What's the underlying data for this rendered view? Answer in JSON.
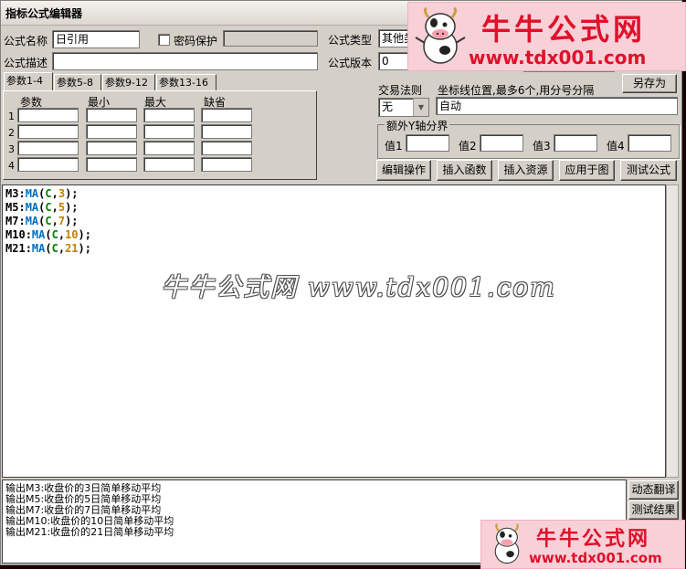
{
  "window": {
    "title": "指标公式编辑器"
  },
  "form": {
    "name_label": "公式名称",
    "name_value": "日引用",
    "password_label": "密码保护",
    "desc_label": "公式描述",
    "desc_value": "",
    "type_label": "公式类型",
    "type_value": "其他类",
    "version_label": "公式版本",
    "version_value": "0"
  },
  "tabs": [
    "参数1-4",
    "参数5-8",
    "参数9-12",
    "参数13-16"
  ],
  "params": {
    "headers": [
      "参数",
      "最小",
      "最大",
      "缺省"
    ],
    "rows": [
      "1",
      "2",
      "3",
      "4"
    ]
  },
  "trade": {
    "rule_label": "交易法则",
    "rule_value": "无",
    "axis_label": "坐标线位置,最多6个,用分号分隔",
    "axis_value": "自动"
  },
  "buttons": {
    "save_as": "另存为",
    "edit_ops": "编辑操作",
    "insert_func": "插入函数",
    "insert_res": "插入资源",
    "apply_chart": "应用于图",
    "test_formula": "测试公式",
    "dyn_translate": "动态翻译",
    "test_result": "测试结果"
  },
  "yaxis": {
    "group_label": "额外Y轴分界",
    "v1": "值1",
    "v2": "值2",
    "v3": "值3",
    "v4": "值4"
  },
  "code": [
    {
      "name": "M3",
      "func": "MA",
      "arg": "C",
      "n": "3"
    },
    {
      "name": "M5",
      "func": "MA",
      "arg": "C",
      "n": "5"
    },
    {
      "name": "M7",
      "func": "MA",
      "arg": "C",
      "n": "7"
    },
    {
      "name": "M10",
      "func": "MA",
      "arg": "C",
      "n": "10"
    },
    {
      "name": "M21",
      "func": "MA",
      "arg": "C",
      "n": "21"
    }
  ],
  "output_lines": [
    "输出M3:收盘价的3日简单移动平均",
    "输出M5:收盘价的5日简单移动平均",
    "输出M7:收盘价的7日简单移动平均",
    "输出M10:收盘价的10日简单移动平均",
    "输出M21:收盘价的21日简单移动平均"
  ],
  "watermark": "牛牛公式网 www.tdx001.com",
  "logo": {
    "cn": "牛牛公式网",
    "url": "www.tdx001.com"
  },
  "colors": {
    "code_name": "#000000",
    "code_func": "#0070c0",
    "code_arg": "#008000",
    "code_num": "#c08000",
    "logo_red": "#e0102a"
  }
}
